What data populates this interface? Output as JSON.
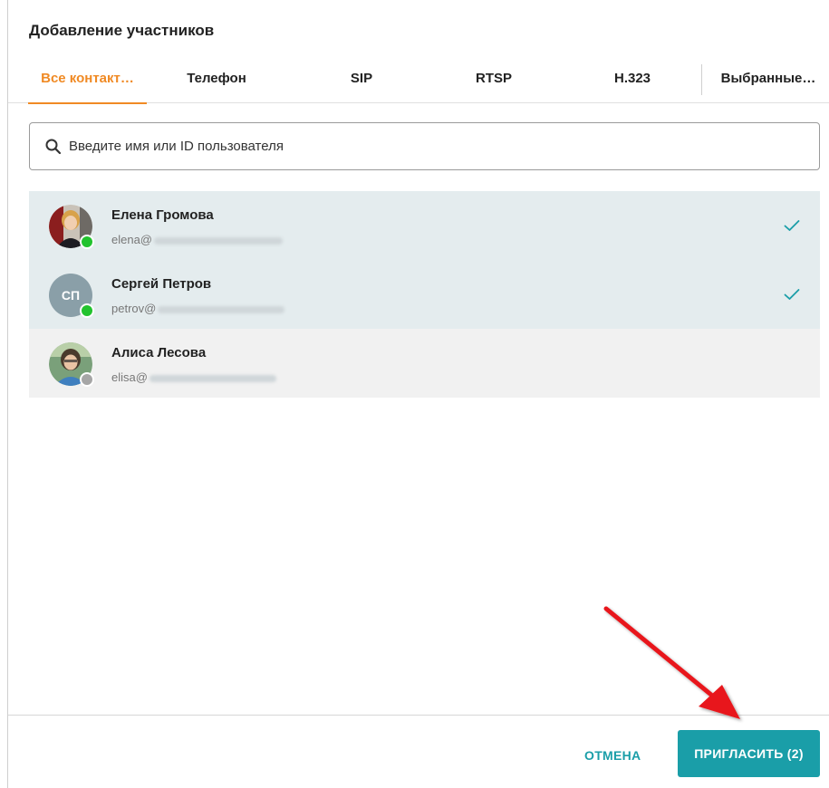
{
  "dialog": {
    "title": "Добавление участников"
  },
  "tabs": [
    {
      "label": "Все контакт…",
      "active": true
    },
    {
      "label": "Телефон",
      "active": false
    },
    {
      "label": "SIP",
      "active": false
    },
    {
      "label": "RTSP",
      "active": false
    },
    {
      "label": "H.323",
      "active": false
    },
    {
      "label": "Выбранные…",
      "active": false
    }
  ],
  "search": {
    "placeholder": "Введите имя или ID пользователя",
    "icon": "search-icon"
  },
  "contacts": [
    {
      "name": "Елена Громова",
      "email_visible": "elena@",
      "avatar": "photo",
      "status": "online",
      "selected": true
    },
    {
      "name": "Сергей Петров",
      "email_visible": "petrov@",
      "avatar_initials": "СП",
      "status": "online",
      "selected": true
    },
    {
      "name": "Алиса Лесова",
      "email_visible": "elisa@",
      "avatar": "photo",
      "status": "offline",
      "selected": false
    }
  ],
  "footer": {
    "cancel_label": "ОТМЕНА",
    "invite_label": "ПРИГЛАСИТЬ (2)"
  },
  "colors": {
    "accent": "#f08a24",
    "primary": "#1a9ea8",
    "online": "#22c32e",
    "offline": "#a6a6a6",
    "selected_row": "#e4ecee",
    "annotation_arrow": "#e8191b"
  }
}
